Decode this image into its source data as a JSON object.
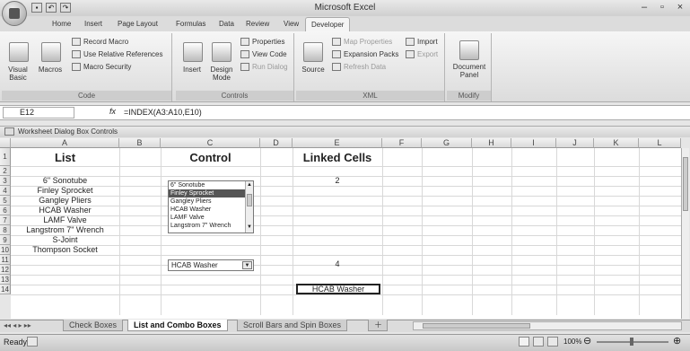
{
  "window": {
    "title": "Microsoft Excel"
  },
  "ribbon_tabs": [
    "Home",
    "Insert",
    "Page Layout",
    "Formulas",
    "Data",
    "Review",
    "View",
    "Developer"
  ],
  "active_tab": "Developer",
  "groups": {
    "code": {
      "label": "Code",
      "visual_basic": "Visual Basic",
      "macros": "Macros",
      "record_macro": "Record Macro",
      "use_relative": "Use Relative References",
      "macro_security": "Macro Security"
    },
    "controls": {
      "label": "Controls",
      "insert": "Insert",
      "design_mode": "Design Mode",
      "properties": "Properties",
      "view_code": "View Code",
      "run_dialog": "Run Dialog"
    },
    "xml": {
      "label": "XML",
      "source": "Source",
      "map_properties": "Map Properties",
      "expansion_packs": "Expansion Packs",
      "refresh_data": "Refresh Data",
      "import": "Import",
      "export": "Export"
    },
    "modify": {
      "label": "Modify",
      "document_panel": "Document Panel"
    }
  },
  "formula_bar": {
    "name_box": "E12",
    "fx": "fx",
    "formula": "=INDEX(A3:A10,E10)"
  },
  "workbook": {
    "title": "Worksheet Dialog Box Controls"
  },
  "columns": [
    "A",
    "B",
    "C",
    "D",
    "E",
    "F",
    "G",
    "H",
    "I",
    "J",
    "K",
    "L"
  ],
  "rows": [
    "1",
    "2",
    "3",
    "4",
    "5",
    "6",
    "7",
    "8",
    "9",
    "10",
    "11",
    "12",
    "13",
    "14"
  ],
  "headers": {
    "list": "List",
    "control": "Control",
    "linked": "Linked Cells"
  },
  "list_items": [
    "6\" Sonotube",
    "Finley Sprocket",
    "Gangley Pliers",
    "HCAB Washer",
    "LAMF Valve",
    "Langstrom 7\" Wrench",
    "S-Joint",
    "Thompson Socket"
  ],
  "listbox_items": [
    "6\" Sonotube",
    "Finley Sprocket",
    "Gangley Pliers",
    "HCAB Washer",
    "LAMF Valve",
    "Langstrom 7\" Wrench"
  ],
  "listbox_selected_index": 1,
  "combo_value": "HCAB Washer",
  "linked": {
    "e3": "2",
    "e10": "4",
    "e12": "HCAB Washer"
  },
  "sheet_tabs": [
    "Check Boxes",
    "List and Combo Boxes",
    "Scroll Bars and Spin Boxes"
  ],
  "active_sheet": "List and Combo Boxes",
  "status": {
    "text": "Ready",
    "zoom": "100%"
  }
}
